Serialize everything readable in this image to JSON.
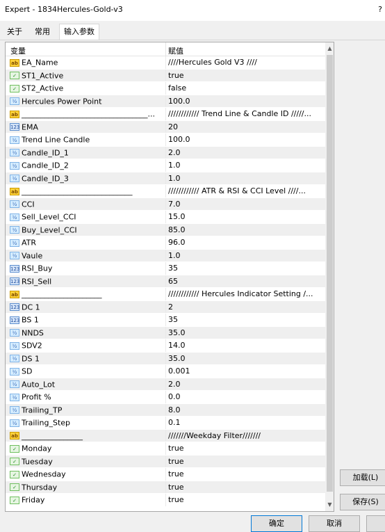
{
  "window": {
    "title": "Expert - 1834Hercules-Gold-v3",
    "help": "?"
  },
  "tabs": [
    {
      "label": "关于"
    },
    {
      "label": "常用"
    },
    {
      "label": "输入参数"
    }
  ],
  "table": {
    "col_variable": "变量",
    "col_value": "赋值",
    "rows": [
      {
        "type": "str",
        "icon": "ab",
        "name": "EA_Name",
        "value": "////Hercules Gold V3 ////"
      },
      {
        "type": "bool",
        "icon": "✓",
        "name": "ST1_Active",
        "value": "true"
      },
      {
        "type": "bool",
        "icon": "✓",
        "name": "ST2_Active",
        "value": "false"
      },
      {
        "type": "dbl",
        "icon": "½",
        "name": "Hercules Power Point",
        "value": "100.0"
      },
      {
        "type": "str",
        "icon": "ab",
        "name": "_________________________________...",
        "value": "////////////  Trend Line & Candle ID  /////..."
      },
      {
        "type": "int",
        "icon": "123",
        "name": "EMA",
        "value": "20"
      },
      {
        "type": "dbl",
        "icon": "½",
        "name": "Trend Line Candle",
        "value": "100.0"
      },
      {
        "type": "dbl",
        "icon": "½",
        "name": "Candle_ID_1",
        "value": "2.0"
      },
      {
        "type": "dbl",
        "icon": "½",
        "name": "Candle_ID_2",
        "value": "1.0"
      },
      {
        "type": "dbl",
        "icon": "½",
        "name": "Candle_ID_3",
        "value": "1.0"
      },
      {
        "type": "str",
        "icon": "ab",
        "name": "_____________________________",
        "value": "////////////  ATR & RSI  & CCI Level   ////..."
      },
      {
        "type": "dbl",
        "icon": "½",
        "name": "CCI",
        "value": "7.0"
      },
      {
        "type": "dbl",
        "icon": "½",
        "name": "Sell_Level_CCI",
        "value": "15.0"
      },
      {
        "type": "dbl",
        "icon": "½",
        "name": "Buy_Level_CCI",
        "value": "85.0"
      },
      {
        "type": "dbl",
        "icon": "½",
        "name": "ATR",
        "value": "96.0"
      },
      {
        "type": "dbl",
        "icon": "½",
        "name": "Vaule",
        "value": "1.0"
      },
      {
        "type": "int",
        "icon": "123",
        "name": "RSI_Buy",
        "value": "35"
      },
      {
        "type": "int",
        "icon": "123",
        "name": "RSI_Sell",
        "value": "65"
      },
      {
        "type": "str",
        "icon": "ab",
        "name": "_____________________",
        "value": "////////////  Hercules Indicator  Setting  /..."
      },
      {
        "type": "int",
        "icon": "123",
        "name": "DC 1",
        "value": "2"
      },
      {
        "type": "int",
        "icon": "123",
        "name": "BS 1",
        "value": "35"
      },
      {
        "type": "dbl",
        "icon": "½",
        "name": "NNDS",
        "value": "35.0"
      },
      {
        "type": "dbl",
        "icon": "½",
        "name": "SDV2",
        "value": "14.0"
      },
      {
        "type": "dbl",
        "icon": "½",
        "name": "DS 1",
        "value": "35.0"
      },
      {
        "type": "dbl",
        "icon": "½",
        "name": "SD",
        "value": "0.001"
      },
      {
        "type": "dbl",
        "icon": "½",
        "name": "Auto_Lot",
        "value": "2.0"
      },
      {
        "type": "dbl",
        "icon": "½",
        "name": "Profit %",
        "value": "0.0"
      },
      {
        "type": "dbl",
        "icon": "½",
        "name": "Trailing_TP",
        "value": "8.0"
      },
      {
        "type": "dbl",
        "icon": "½",
        "name": "Trailing_Step",
        "value": "0.1"
      },
      {
        "type": "str",
        "icon": "ab",
        "name": "________________",
        "value": "///////Weekday Filter///////"
      },
      {
        "type": "bool",
        "icon": "✓",
        "name": "Monday",
        "value": "true"
      },
      {
        "type": "bool",
        "icon": "✓",
        "name": "Tuesday",
        "value": "true"
      },
      {
        "type": "bool",
        "icon": "✓",
        "name": "Wednesday",
        "value": "true"
      },
      {
        "type": "bool",
        "icon": "✓",
        "name": "Thursday",
        "value": "true"
      },
      {
        "type": "bool",
        "icon": "✓",
        "name": "Friday",
        "value": "true"
      }
    ]
  },
  "buttons": {
    "load": "加载(L)",
    "save": "保存(S)",
    "ok": "确定",
    "cancel": "取消",
    "reset": ""
  },
  "icons": {
    "scroll_up": "chevron-up-icon",
    "scroll_down": "chevron-down-icon"
  }
}
